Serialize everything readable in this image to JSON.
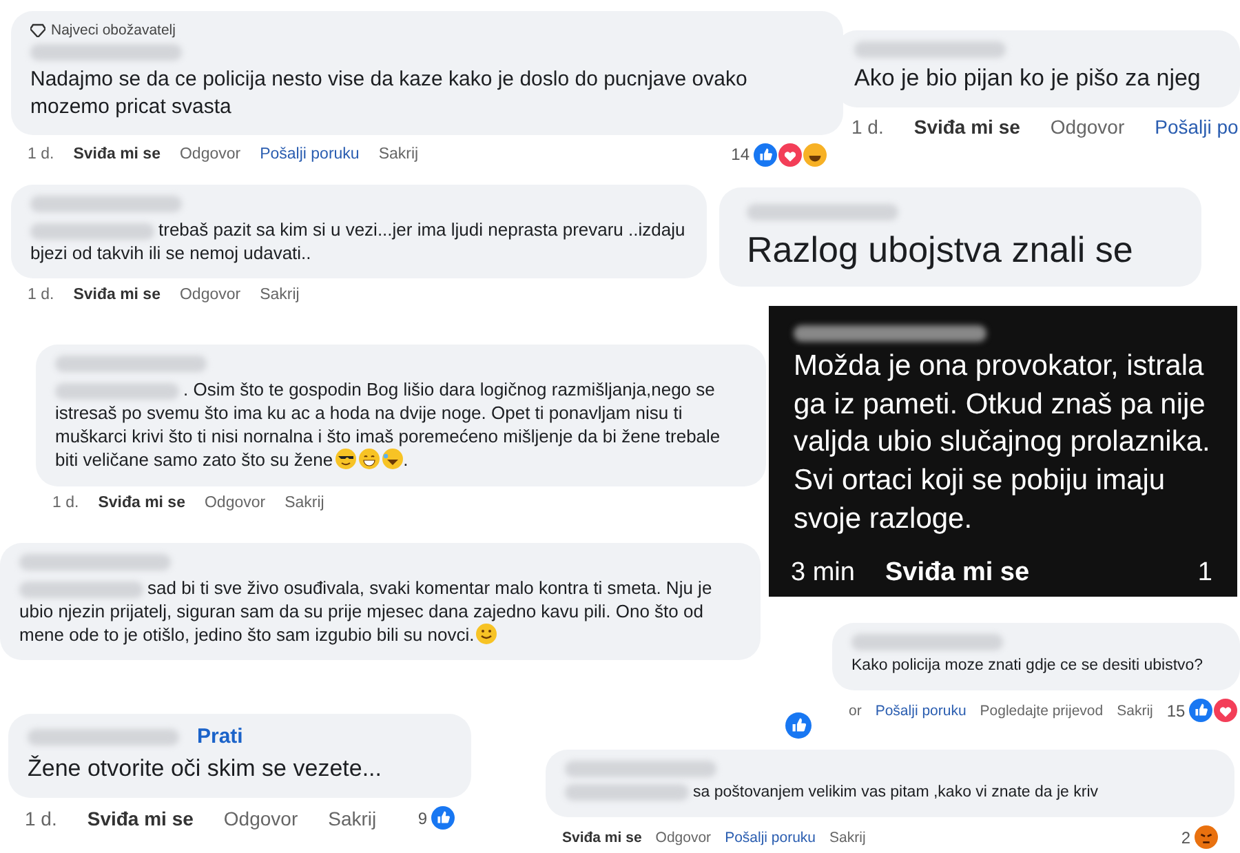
{
  "snippets": [
    {
      "kind": "medium",
      "badge": "Najveci obožavatelj",
      "text": "Nadajmo se da ce policija nesto vise da kaze kako je doslo do pucnjave ovako mozemo pricat svasta",
      "actions": [
        {
          "label": "1 d.",
          "kind": "time"
        },
        {
          "label": "Sviđa mi se",
          "kind": "like"
        },
        {
          "label": "Odgovor",
          "kind": "plain"
        },
        {
          "label": "Pošalji poruku",
          "kind": "link"
        },
        {
          "label": "Sakrij",
          "kind": "plain"
        }
      ],
      "reactions": {
        "count": "14"
      }
    },
    {
      "kind": "large",
      "text": "Ako je bio pijan ko je pišo za njeg",
      "actions": [
        {
          "label": "1 d.",
          "kind": "time"
        },
        {
          "label": "Sviđa mi se",
          "kind": "like"
        },
        {
          "label": "Odgovor",
          "kind": "plain"
        },
        {
          "label": "Pošalji po",
          "kind": "link"
        }
      ]
    },
    {
      "kind": "small",
      "text": "trebaš pazit sa kim si u vezi...jer ima ljudi neprasta prevaru ..izdaju bjezi od takvih ili se nemoj udavati..",
      "actions": [
        {
          "label": "1 d.",
          "kind": "time"
        },
        {
          "label": "Sviđa mi se",
          "kind": "like"
        },
        {
          "label": "Odgovor",
          "kind": "plain"
        },
        {
          "label": "Sakrij",
          "kind": "plain"
        }
      ]
    },
    {
      "kind": "small",
      "text": ". Osim što te gospodin Bog lišio dara logičnog razmišljanja,nego se istresaš po svemu što ima ku ac a hoda na dvije noge. Opet ti ponavljam nisu ti muškarci krivi što ti nisi nornalna i što imaš poremećeno mišljenje da bi žene trebale biti veličane samo zato što su žene",
      "tail": ".",
      "actions": [
        {
          "label": "1 d.",
          "kind": "time"
        },
        {
          "label": "Sviđa mi se",
          "kind": "like"
        },
        {
          "label": "Odgovor",
          "kind": "plain"
        },
        {
          "label": "Sakrij",
          "kind": "plain"
        }
      ]
    },
    {
      "kind": "headline",
      "text": "Razlog ubojstva znali se"
    },
    {
      "kind": "dark",
      "text": "Možda je ona provokator, istrala ga iz pameti. Otkud znaš pa nije valjda ubio slučajnog prolaznika. Svi ortaci koji se pobiju imaju svoje razloge.",
      "actions": [
        {
          "label": "3 min",
          "kind": "time"
        },
        {
          "label": "Sviđa mi se",
          "kind": "like"
        }
      ],
      "reactions": {
        "count": "1"
      }
    },
    {
      "kind": "small",
      "text": "sad bi ti sve živo osuđivala, svaki komentar malo kontra ti smeta. Nju je ubio njezin prijatelj, siguran sam da su prije mjesec dana zajedno kavu pili. Ono što od mene ode to je otišlo, jedino što sam izgubio bili su novci."
    },
    {
      "kind": "tiny",
      "text": "Kako policija moze znati gdje ce se desiti ubistvo?",
      "actions": [
        {
          "label": "or",
          "kind": "plain"
        },
        {
          "label": "Pošalji poruku",
          "kind": "link"
        },
        {
          "label": "Pogledajte prijevod",
          "kind": "plain"
        },
        {
          "label": "Sakrij",
          "kind": "plain"
        }
      ],
      "reactions": {
        "count": "15"
      }
    },
    {
      "kind": "large",
      "follow": "Prati",
      "text": "Žene otvorite oči skim se vezete...",
      "actions": [
        {
          "label": "1 d.",
          "kind": "time"
        },
        {
          "label": "Sviđa mi se",
          "kind": "like"
        },
        {
          "label": "Odgovor",
          "kind": "plain"
        },
        {
          "label": "Sakrij",
          "kind": "plain"
        }
      ],
      "reactions": {
        "count": "9"
      }
    },
    {
      "kind": "tiny",
      "text": "sa poštovanjem velikim vas pitam ,kako vi znate da je kriv",
      "actions": [
        {
          "label": "Sviđa mi se",
          "kind": "like"
        },
        {
          "label": "Odgovor",
          "kind": "plain"
        },
        {
          "label": "Pošalji poruku",
          "kind": "link"
        },
        {
          "label": "Sakrij",
          "kind": "plain"
        }
      ],
      "reactions": {
        "count": "2"
      }
    }
  ]
}
